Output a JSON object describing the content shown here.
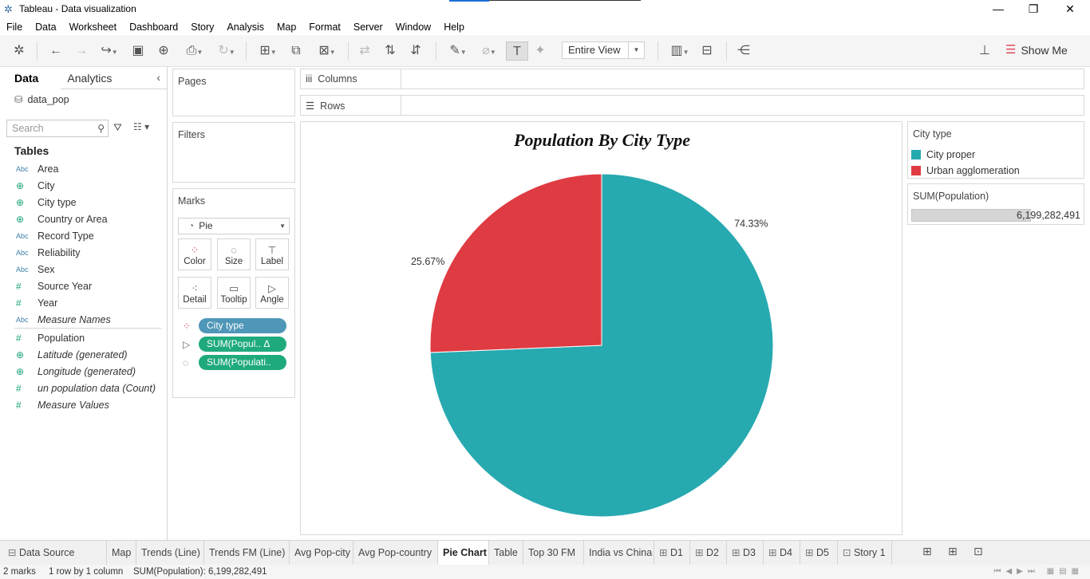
{
  "window": {
    "title": "Tableau - Data visualization",
    "minimize": "—",
    "restore": "❐",
    "close": "✕"
  },
  "menu": [
    "File",
    "Data",
    "Worksheet",
    "Dashboard",
    "Story",
    "Analysis",
    "Map",
    "Format",
    "Server",
    "Window",
    "Help"
  ],
  "toolbar": {
    "fit_select": "Entire View",
    "show_me": "Show Me"
  },
  "data_pane": {
    "tabs": [
      "Data",
      "Analytics"
    ],
    "data_source": "data_pop",
    "search_placeholder": "Search",
    "tables_heading": "Tables",
    "fields": [
      {
        "type": "Abc",
        "name": "Area"
      },
      {
        "type": "geo",
        "name": "City"
      },
      {
        "type": "geo",
        "name": "City type"
      },
      {
        "type": "geo",
        "name": "Country or Area"
      },
      {
        "type": "Abc",
        "name": "Record Type"
      },
      {
        "type": "Abc",
        "name": "Reliability"
      },
      {
        "type": "Abc",
        "name": "Sex"
      },
      {
        "type": "#",
        "name": "Source Year"
      },
      {
        "type": "#",
        "name": "Year"
      },
      {
        "type": "Abc",
        "name": "Measure Names"
      }
    ],
    "measures": [
      {
        "type": "#",
        "name": "Population"
      },
      {
        "type": "geo",
        "name": "Latitude (generated)"
      },
      {
        "type": "geo",
        "name": "Longitude (generated)"
      },
      {
        "type": "#",
        "name": "un population data (Count)"
      },
      {
        "type": "#",
        "name": "Measure Values"
      }
    ]
  },
  "cards": {
    "pages": "Pages",
    "filters": "Filters",
    "marks": "Marks",
    "mark_type": "Pie",
    "mark_buttons": [
      "Color",
      "Size",
      "Label",
      "Detail",
      "Tooltip",
      "Angle"
    ],
    "pills": [
      {
        "label": "City type",
        "color": "#4f97b8"
      },
      {
        "label": "SUM(Popul..  Δ",
        "color": "#1faa7d"
      },
      {
        "label": "SUM(Populati..",
        "color": "#1faa7d"
      }
    ]
  },
  "shelves": {
    "columns": "Columns",
    "rows": "Rows"
  },
  "viz": {
    "title": "Population By City Type"
  },
  "chart_data": {
    "type": "pie",
    "title": "Population By City Type",
    "categories": [
      "City proper",
      "Urban agglomeration"
    ],
    "values": [
      74.33,
      25.67
    ],
    "labels": [
      "74.33%",
      "25.67%"
    ],
    "colors": [
      "#27a9b0",
      "#df3b42"
    ],
    "total": "6,199,282,491",
    "legend_position": "right"
  },
  "legend": {
    "title": "City type",
    "items": [
      {
        "label": "City proper",
        "color": "#27a9b0"
      },
      {
        "label": "Urban agglomeration",
        "color": "#df3b42"
      }
    ]
  },
  "size_legend": {
    "title": "SUM(Population)",
    "value": "6,199,282,491"
  },
  "sheets": [
    "Data Source",
    "Map",
    "Trends (Line)",
    "Trends FM (Line)",
    "Avg Pop-city",
    "Avg Pop-country",
    "Pie Chart",
    "Table",
    "Top 30 FM",
    "India vs China",
    "D1",
    "D2",
    "D3",
    "D4",
    "D5",
    "Story 1"
  ],
  "active_sheet": "Pie Chart",
  "status": {
    "marks": "2 marks",
    "dims": "1 row by 1 column",
    "sum": "SUM(Population): 6,199,282,491"
  }
}
